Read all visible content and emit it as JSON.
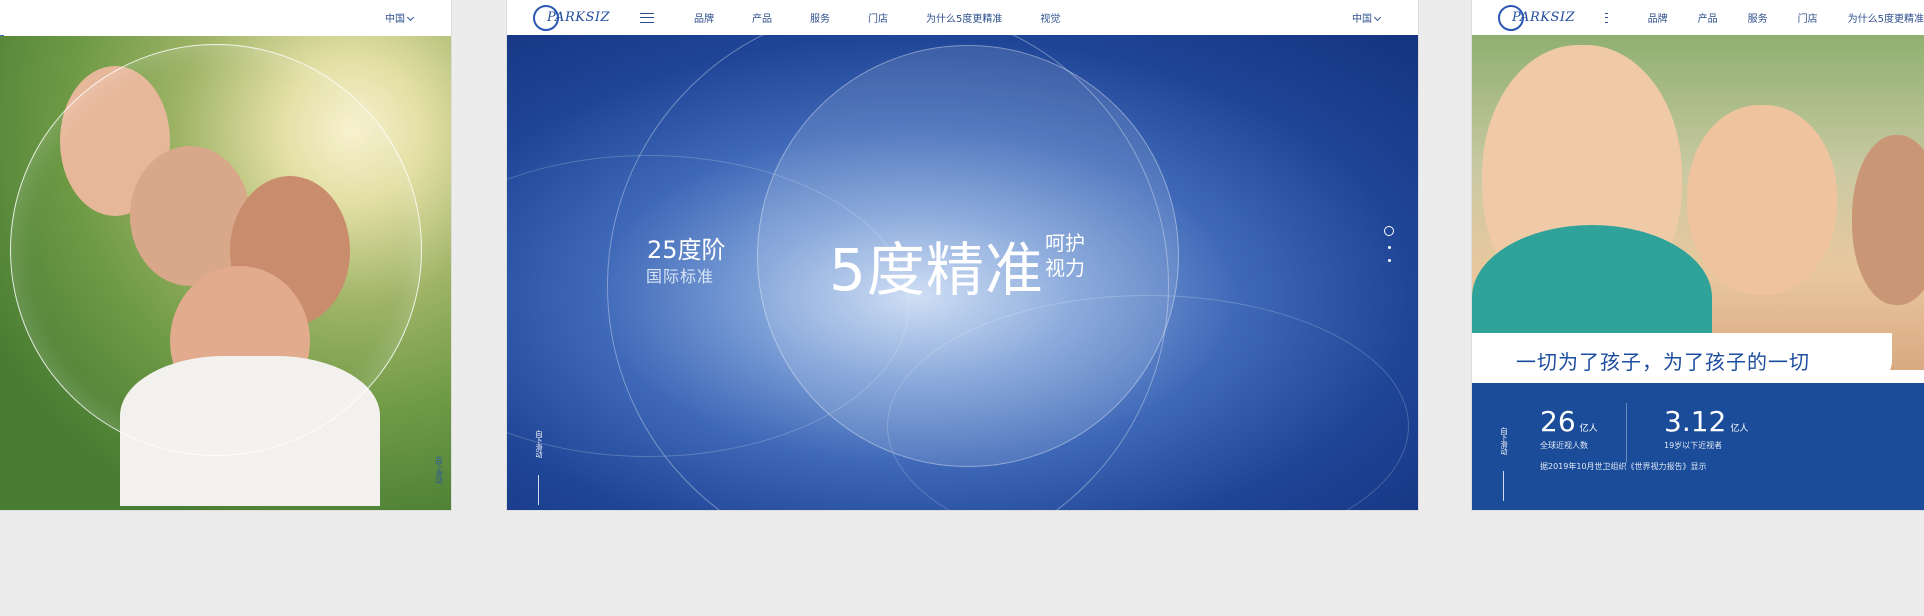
{
  "nav": {
    "brand": "PARKSIZ",
    "items": [
      "品牌",
      "产品",
      "服务",
      "门店",
      "为什么5度更精准",
      "视觉"
    ],
    "lang": "中国"
  },
  "left_panel": {
    "lang": "中国",
    "scroll_label": "向下滑动"
  },
  "mid_panel": {
    "headline_left_1": "25度阶",
    "headline_left_2": "国际标准",
    "headline_main": "5度精准",
    "headline_right": "呵护视力",
    "scroll_label": "向下滑动"
  },
  "right_panel": {
    "slogan": "一切为了孩子，为了孩子的一切",
    "stat1": {
      "num": "26",
      "unit": "亿人",
      "desc": "全球近视人数"
    },
    "stat2": {
      "num": "3.12",
      "unit": "亿人",
      "desc": "19岁以下近视者"
    },
    "source": "据2019年10月世卫组织《世界视力报告》显示",
    "scroll_label": "向下滑动"
  },
  "colors": {
    "brand_blue": "#1a4c99",
    "nav_text": "#2d4e8d",
    "background": "#ececec"
  }
}
